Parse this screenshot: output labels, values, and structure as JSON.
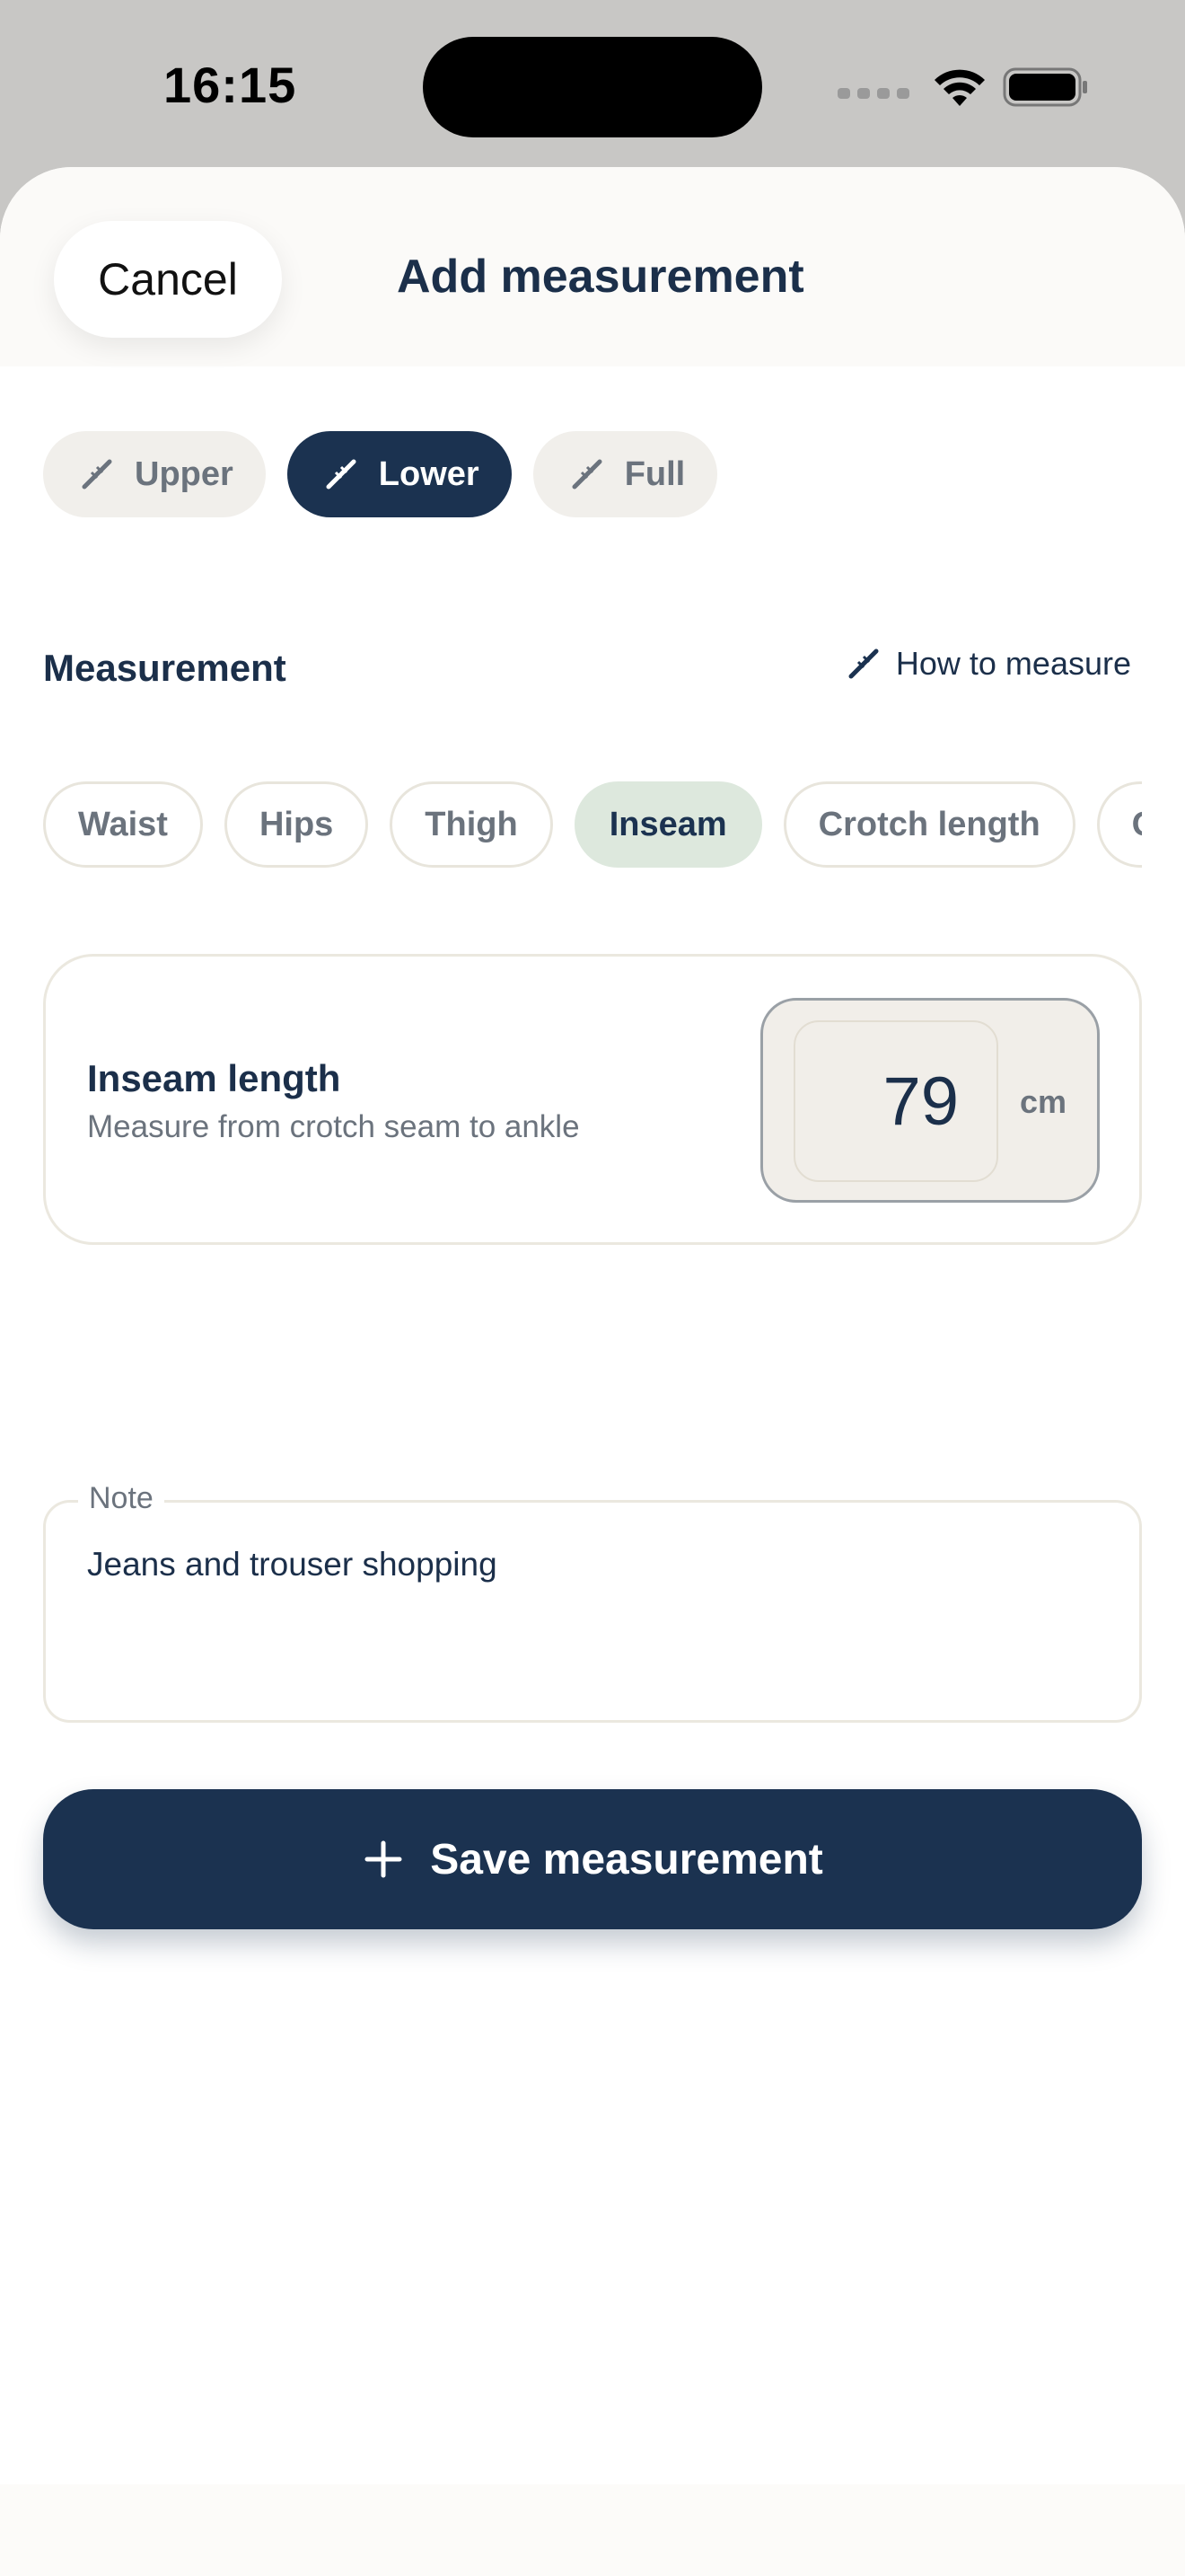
{
  "status": {
    "time": "16:15"
  },
  "header": {
    "cancel_label": "Cancel",
    "title": "Add measurement"
  },
  "segments": [
    {
      "label": "Upper",
      "icon": "ruler-icon",
      "active": false
    },
    {
      "label": "Lower",
      "icon": "ruler-icon",
      "active": true
    },
    {
      "label": "Full",
      "icon": "ruler-icon",
      "active": false
    }
  ],
  "section": {
    "label": "Measurement",
    "how_to_label": "How to measure"
  },
  "chips": [
    {
      "label": "Waist",
      "active": false
    },
    {
      "label": "Hips",
      "active": false
    },
    {
      "label": "Thigh",
      "active": false
    },
    {
      "label": "Inseam",
      "active": true
    },
    {
      "label": "Crotch length",
      "active": false
    },
    {
      "label": "Outseam",
      "active": false
    }
  ],
  "measurement": {
    "title": "Inseam length",
    "description": "Measure from crotch seam to ankle",
    "value": "79",
    "unit": "cm"
  },
  "note": {
    "label": "Note",
    "value": "Jeans and trouser shopping"
  },
  "save": {
    "label": "Save measurement",
    "icon": "plus-icon"
  },
  "colors": {
    "primary": "#1b3250",
    "chip_active": "#dde8dd",
    "segment_bg": "#f1efeb"
  }
}
